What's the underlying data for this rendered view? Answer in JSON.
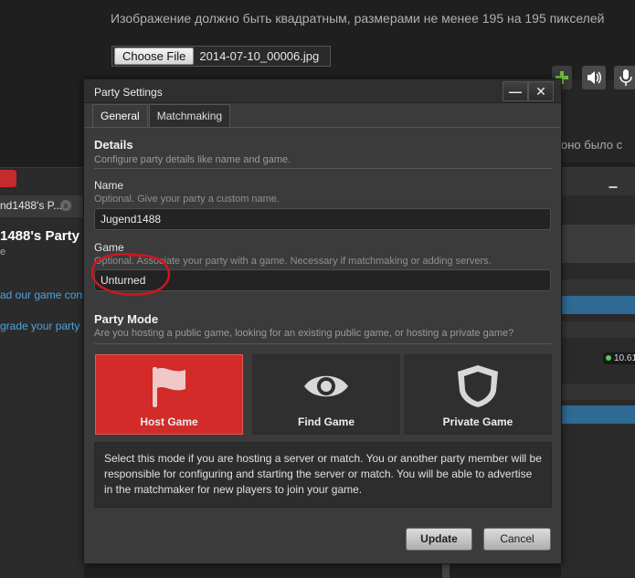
{
  "background": {
    "hint_text": "Изображение должно быть квадратным, размерами не менее 195 на 195 пикселей",
    "choose_file_label": "Choose File",
    "file_name": "2014-07-10_00006.jpg",
    "right_fragment": "оно было с",
    "left_tab_label": "nd1488's P...",
    "left_tab_close": "x",
    "party_title": "1488's Party",
    "party_sub": "e",
    "link1": "ad our game conn",
    "link2": "grade your party t",
    "ip_text": "10.61",
    "icon_names": [
      "plus-icon",
      "speaker-icon",
      "microphone-icon"
    ]
  },
  "dialog": {
    "title": "Party Settings",
    "minimize_label": "—",
    "close_label": "✕",
    "tabs": [
      {
        "label": "General",
        "active": true
      },
      {
        "label": "Matchmaking",
        "active": false
      }
    ],
    "details": {
      "title": "Details",
      "description": "Configure party details like name and game."
    },
    "name": {
      "label": "Name",
      "hint": "Optional. Give your party a custom name.",
      "value": "Jugend1488"
    },
    "game": {
      "label": "Game",
      "hint": "Optional. Associate your party with a game. Necessary if matchmaking or adding servers.",
      "value": "Unturned"
    },
    "party_mode": {
      "title": "Party Mode",
      "description": "Are you hosting a public game, looking for an existing public game, or hosting a private game?",
      "modes": [
        {
          "label": "Host Game",
          "icon": "flag-icon",
          "selected": true
        },
        {
          "label": "Find Game",
          "icon": "eye-icon",
          "selected": false
        },
        {
          "label": "Private Game",
          "icon": "shield-icon",
          "selected": false
        }
      ],
      "info": "Select this mode if you are hosting a server or match. You or another party member will be responsible for configuring and starting the server or match. You will be able to advertise in the matchmaker for new players to join your game."
    },
    "buttons": {
      "update": "Update",
      "cancel": "Cancel"
    },
    "colors": {
      "selected_mode": "#d32a2a",
      "annotation": "#d0161c"
    }
  }
}
